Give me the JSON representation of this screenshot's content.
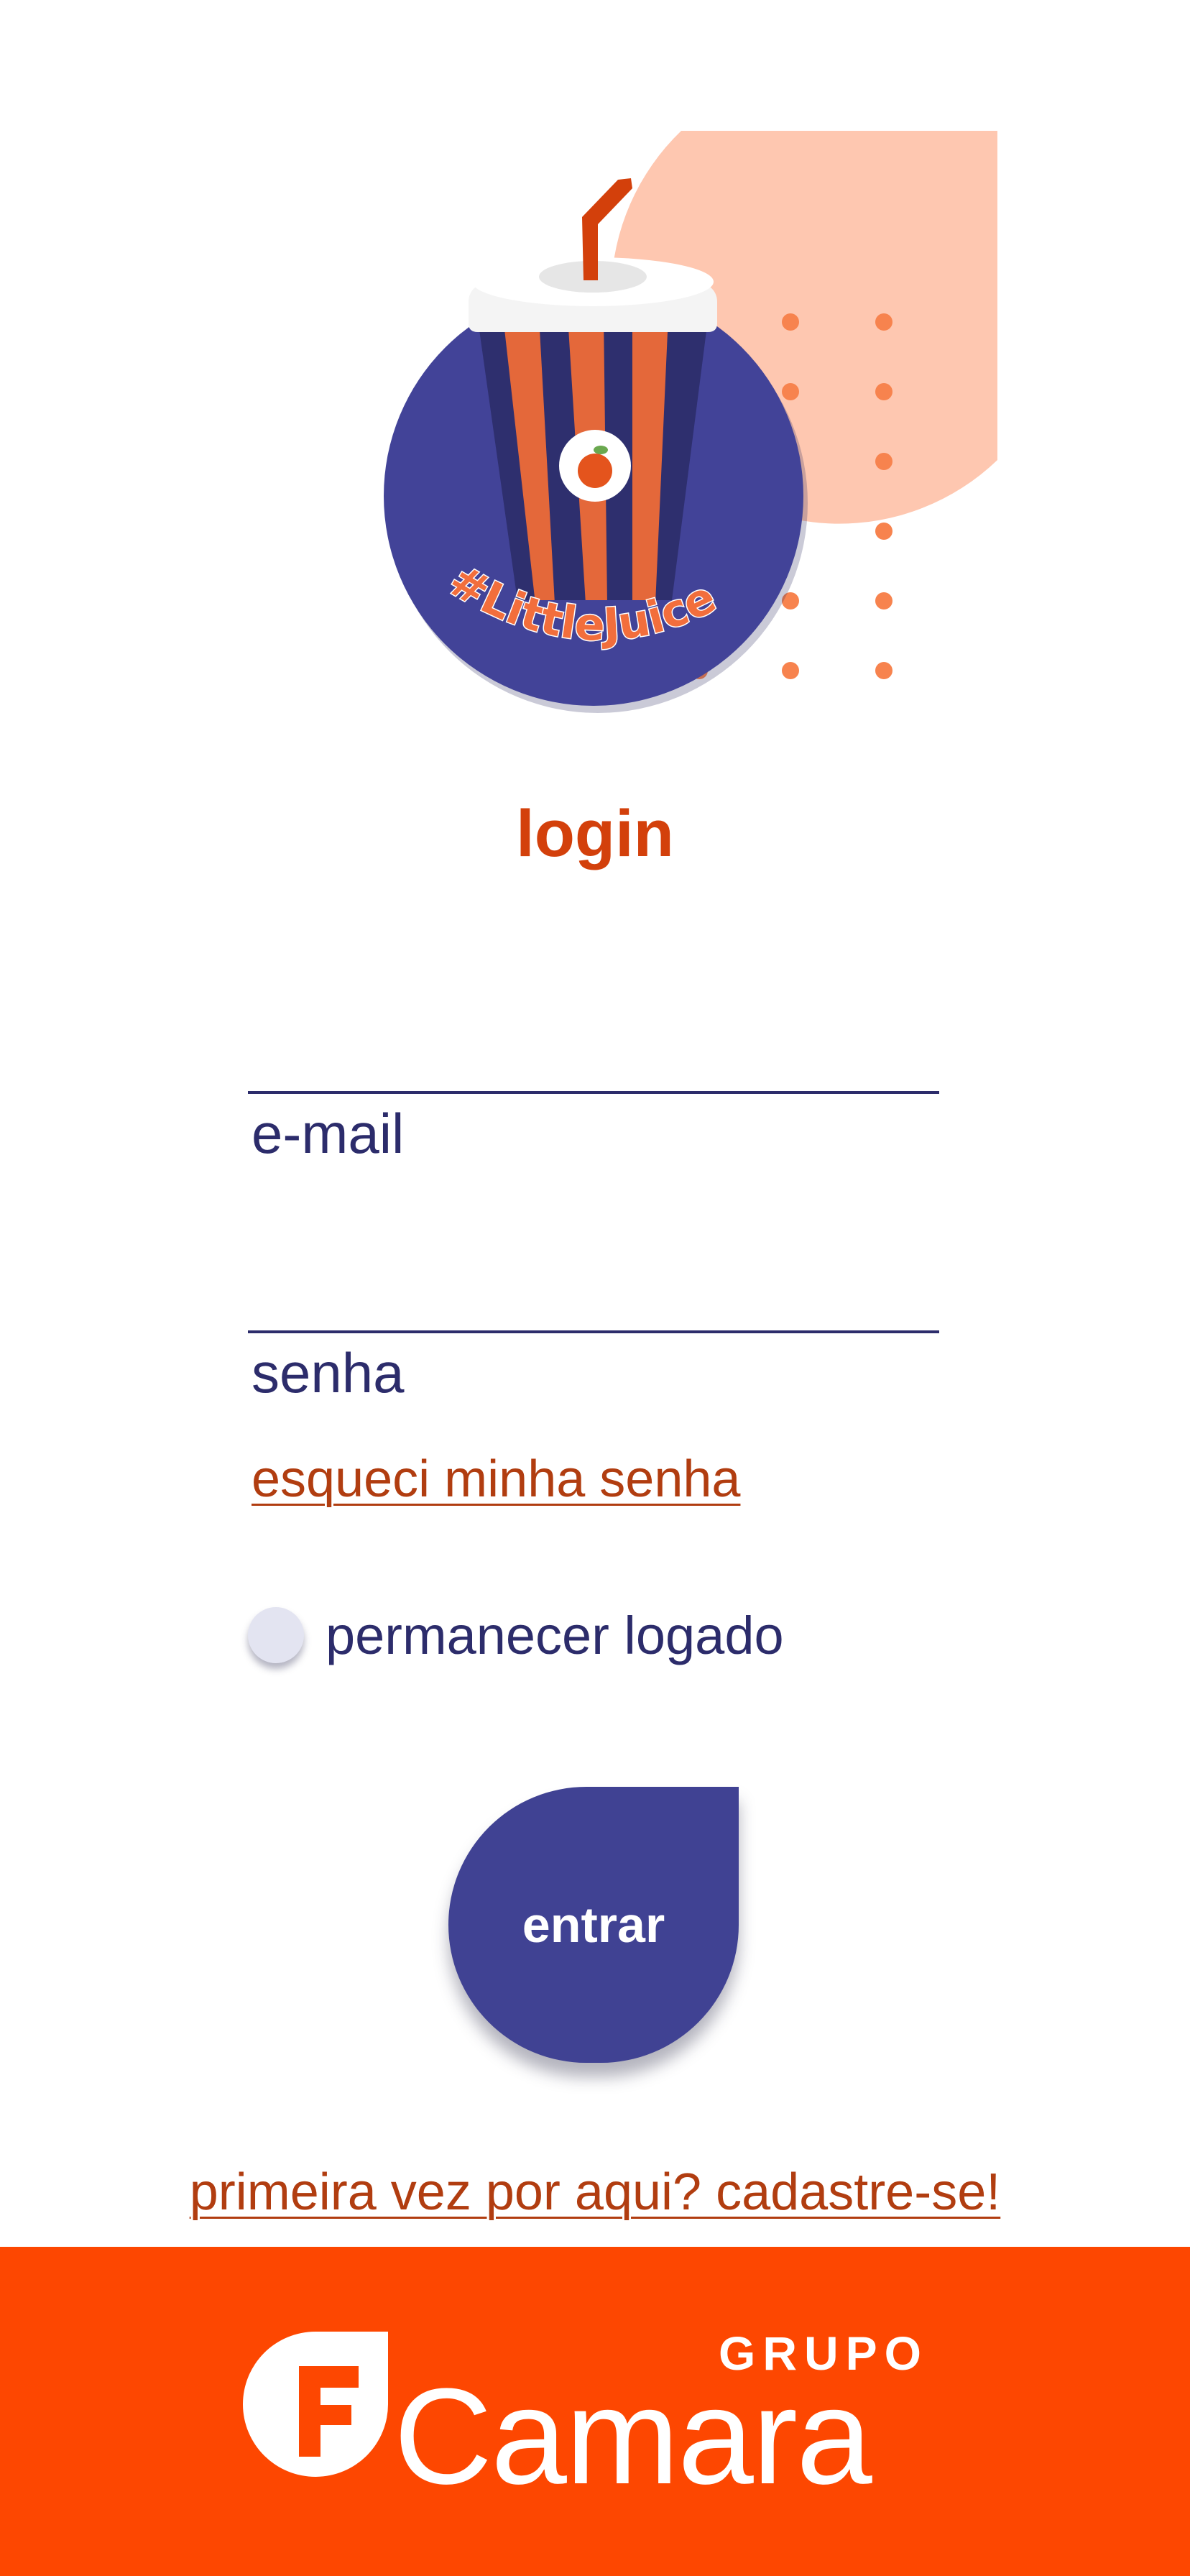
{
  "app": {
    "logo_text": "#LittleJuice"
  },
  "login": {
    "title": "login",
    "email_placeholder": "e-mail",
    "password_placeholder": "senha",
    "forgot_password": "esqueci minha senha",
    "remember_label": "permanecer logado",
    "enter_label": "entrar",
    "signup": "primeira vez por aqui? cadastre-se!"
  },
  "footer": {
    "brand_top": "GRUPO",
    "brand_name": "Camara"
  },
  "colors": {
    "accent_orange": "#d3400b",
    "navy": "#2c2c6b",
    "button": "#404293",
    "footer": "#fd4701",
    "peach": "#fec7b0"
  },
  "icons": {
    "logo": "juice-cup-icon",
    "brand": "camara-f-logo-icon"
  }
}
